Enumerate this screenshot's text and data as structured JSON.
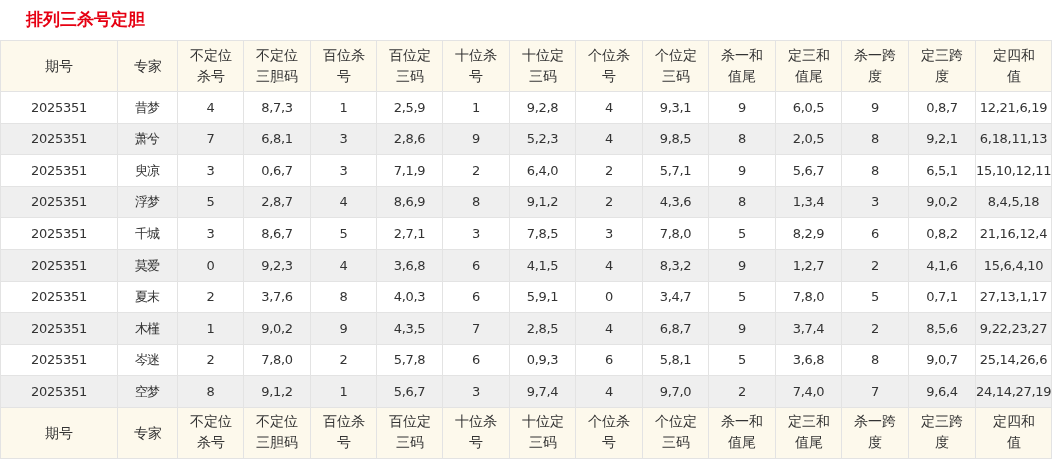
{
  "title": "排列三杀号定胆",
  "table": {
    "columns": [
      "期号",
      "专家",
      "不定位杀号",
      "不定位三胆码",
      "百位杀号",
      "百位定三码",
      "十位杀号",
      "十位定三码",
      "个位杀号",
      "个位定三码",
      "杀一和值尾",
      "定三和值尾",
      "杀一跨度",
      "定三跨度",
      "定四和值"
    ],
    "rows": [
      [
        "2025351",
        "昔梦",
        "4",
        "8,7,3",
        "1",
        "2,5,9",
        "1",
        "9,2,8",
        "4",
        "9,3,1",
        "9",
        "6,0,5",
        "9",
        "0,8,7",
        "12,21,6,19"
      ],
      [
        "2025351",
        "萧兮",
        "7",
        "6,8,1",
        "3",
        "2,8,6",
        "9",
        "5,2,3",
        "4",
        "9,8,5",
        "8",
        "2,0,5",
        "8",
        "9,2,1",
        "6,18,11,13"
      ],
      [
        "2025351",
        "臾凉",
        "3",
        "0,6,7",
        "3",
        "7,1,9",
        "2",
        "6,4,0",
        "2",
        "5,7,1",
        "9",
        "5,6,7",
        "8",
        "6,5,1",
        "15,10,12,11"
      ],
      [
        "2025351",
        "浮梦",
        "5",
        "2,8,7",
        "4",
        "8,6,9",
        "8",
        "9,1,2",
        "2",
        "4,3,6",
        "8",
        "1,3,4",
        "3",
        "9,0,2",
        "8,4,5,18"
      ],
      [
        "2025351",
        "千城",
        "3",
        "8,6,7",
        "5",
        "2,7,1",
        "3",
        "7,8,5",
        "3",
        "7,8,0",
        "5",
        "8,2,9",
        "6",
        "0,8,2",
        "21,16,12,4"
      ],
      [
        "2025351",
        "莫爱",
        "0",
        "9,2,3",
        "4",
        "3,6,8",
        "6",
        "4,1,5",
        "4",
        "8,3,2",
        "9",
        "1,2,7",
        "2",
        "4,1,6",
        "15,6,4,10"
      ],
      [
        "2025351",
        "夏末",
        "2",
        "3,7,6",
        "8",
        "4,0,3",
        "6",
        "5,9,1",
        "0",
        "3,4,7",
        "5",
        "7,8,0",
        "5",
        "0,7,1",
        "27,13,1,17"
      ],
      [
        "2025351",
        "木槿",
        "1",
        "9,0,2",
        "9",
        "4,3,5",
        "7",
        "2,8,5",
        "4",
        "6,8,7",
        "9",
        "3,7,4",
        "2",
        "8,5,6",
        "9,22,23,27"
      ],
      [
        "2025351",
        "岑迷",
        "2",
        "7,8,0",
        "2",
        "5,7,8",
        "6",
        "0,9,3",
        "6",
        "5,8,1",
        "5",
        "3,6,8",
        "8",
        "9,0,7",
        "25,14,26,6"
      ],
      [
        "2025351",
        "空梦",
        "8",
        "9,1,2",
        "1",
        "5,6,7",
        "3",
        "9,7,4",
        "4",
        "9,7,0",
        "2",
        "7,4,0",
        "7",
        "9,6,4",
        "24,14,27,19"
      ]
    ],
    "footer_columns": [
      "期号",
      "专家",
      "不定位杀号",
      "不定位三胆码",
      "百位杀号",
      "百位定三码",
      "十位杀号",
      "十位定三码",
      "个位杀号",
      "个位定三码",
      "杀一和值尾",
      "定三和值尾",
      "杀一跨度",
      "定三跨度",
      "定四和值"
    ]
  }
}
